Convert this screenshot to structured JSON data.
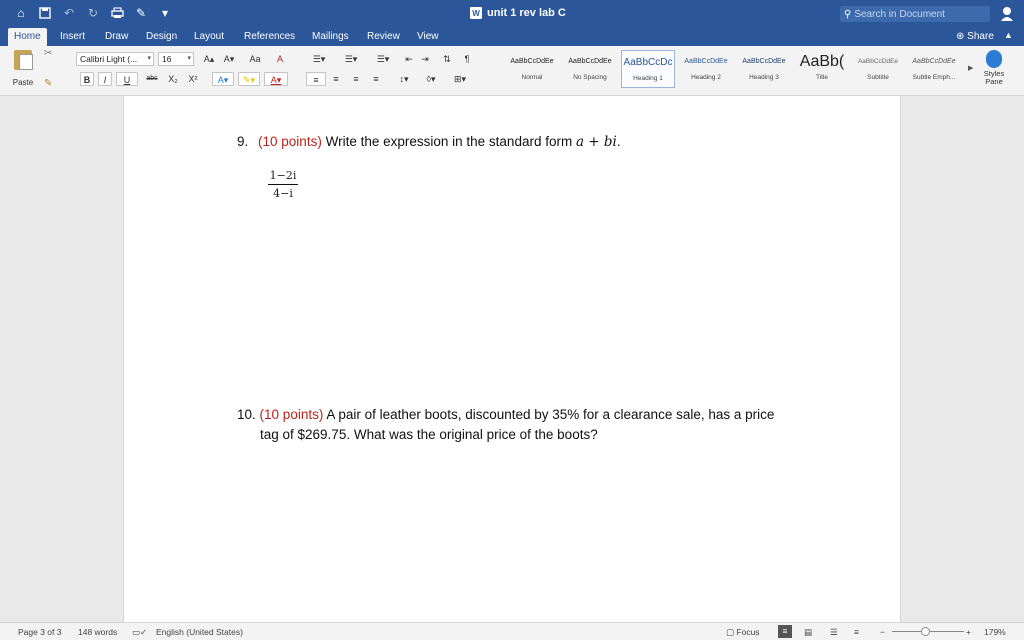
{
  "titlebar": {
    "title": "unit 1 rev lab C",
    "word_badge": "W",
    "search_placeholder": "Search in Document",
    "icons": [
      "home-icon",
      "save-icon",
      "undo-icon",
      "redo-icon",
      "print-icon",
      "edit-icon",
      "customize-icon"
    ]
  },
  "tabs": [
    "Home",
    "Insert",
    "Draw",
    "Design",
    "Layout",
    "References",
    "Mailings",
    "Review",
    "View"
  ],
  "active_tab": "Home",
  "share_label": "Share",
  "ribbon": {
    "paste_label": "Paste",
    "font_name": "Calibri Light (...",
    "font_size": "16",
    "styles": [
      {
        "preview": "AaBbCcDdEe",
        "name": "Normal"
      },
      {
        "preview": "AaBbCcDdEe",
        "name": "No Spacing"
      },
      {
        "preview": "AaBbCcDc",
        "name": "Heading 1"
      },
      {
        "preview": "AaBbCcDdEe",
        "name": "Heading 2"
      },
      {
        "preview": "AaBbCcDdEe",
        "name": "Heading 3"
      },
      {
        "preview": "AaBb(",
        "name": "Title"
      },
      {
        "preview": "AaBbCcDdEe",
        "name": "Subtitle"
      },
      {
        "preview": "AaBbCcDdEe",
        "name": "Subtle Emph..."
      }
    ],
    "styles_pane_label": "Styles Pane"
  },
  "document": {
    "q9": {
      "number": "9.",
      "points": "(10 points)",
      "text": "Write the expression in the standard form ",
      "math": "a + bi",
      "end": ".",
      "fraction_numerator": "1−2i",
      "fraction_denominator": "4−i"
    },
    "q10": {
      "number": "10.",
      "points": "(10 points)",
      "line1": "A pair of leather boots, discounted by 35% for a clearance sale, has a price",
      "line2": "tag of $269.75. What was the original price of the boots?"
    }
  },
  "statusbar": {
    "page": "Page 3 of 3",
    "words": "148 words",
    "language": "English (United States)",
    "focus": "Focus",
    "zoom": "179%",
    "zoom_fraction": 0.47
  },
  "colors": {
    "brand": "#2b579a",
    "points_red": "#c0221b"
  }
}
